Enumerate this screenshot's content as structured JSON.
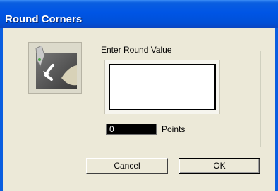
{
  "window": {
    "title": "Round Corners"
  },
  "icon": {
    "name": "round-corners-icon"
  },
  "group": {
    "label": "Enter Round Value"
  },
  "round_value": {
    "value": "0",
    "unit_label": "Points"
  },
  "buttons": {
    "cancel_label": "Cancel",
    "ok_label": "OK"
  },
  "colors": {
    "titlebar": "#0055e5",
    "dialog_background": "#ece9d8",
    "input_background": "#000000"
  }
}
